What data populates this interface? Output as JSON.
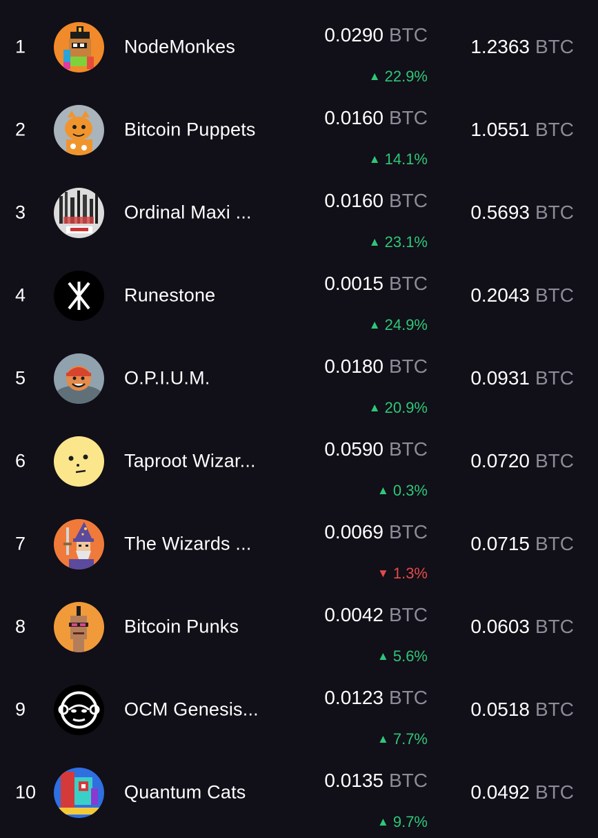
{
  "rows": [
    {
      "rank": "1",
      "name": "NodeMonkes",
      "price": "0.0290",
      "price_unit": "BTC",
      "change_dir": "up",
      "change": "22.9%",
      "volume": "1.2363",
      "volume_unit": "BTC",
      "avatar_icon": "nodemonkes-avatar-icon"
    },
    {
      "rank": "2",
      "name": "Bitcoin Puppets",
      "price": "0.0160",
      "price_unit": "BTC",
      "change_dir": "up",
      "change": "14.1%",
      "volume": "1.0551",
      "volume_unit": "BTC",
      "avatar_icon": "bitcoin-puppets-avatar-icon"
    },
    {
      "rank": "3",
      "name": "Ordinal Maxi ...",
      "price": "0.0160",
      "price_unit": "BTC",
      "change_dir": "up",
      "change": "23.1%",
      "volume": "0.5693",
      "volume_unit": "BTC",
      "avatar_icon": "ordinal-maxi-avatar-icon"
    },
    {
      "rank": "4",
      "name": "Runestone",
      "price": "0.0015",
      "price_unit": "BTC",
      "change_dir": "up",
      "change": "24.9%",
      "volume": "0.2043",
      "volume_unit": "BTC",
      "avatar_icon": "runestone-avatar-icon"
    },
    {
      "rank": "5",
      "name": "O.P.I.U.M.",
      "price": "0.0180",
      "price_unit": "BTC",
      "change_dir": "up",
      "change": "20.9%",
      "volume": "0.0931",
      "volume_unit": "BTC",
      "avatar_icon": "opium-avatar-icon"
    },
    {
      "rank": "6",
      "name": "Taproot Wizar...",
      "price": "0.0590",
      "price_unit": "BTC",
      "change_dir": "up",
      "change": "0.3%",
      "volume": "0.0720",
      "volume_unit": "BTC",
      "avatar_icon": "taproot-wizards-avatar-icon"
    },
    {
      "rank": "7",
      "name": "The Wizards ...",
      "price": "0.0069",
      "price_unit": "BTC",
      "change_dir": "down",
      "change": "1.3%",
      "volume": "0.0715",
      "volume_unit": "BTC",
      "avatar_icon": "the-wizards-avatar-icon"
    },
    {
      "rank": "8",
      "name": "Bitcoin Punks",
      "price": "0.0042",
      "price_unit": "BTC",
      "change_dir": "up",
      "change": "5.6%",
      "volume": "0.0603",
      "volume_unit": "BTC",
      "avatar_icon": "bitcoin-punks-avatar-icon"
    },
    {
      "rank": "9",
      "name": "OCM Genesis...",
      "price": "0.0123",
      "price_unit": "BTC",
      "change_dir": "up",
      "change": "7.7%",
      "volume": "0.0518",
      "volume_unit": "BTC",
      "avatar_icon": "ocm-genesis-avatar-icon"
    },
    {
      "rank": "10",
      "name": "Quantum Cats",
      "price": "0.0135",
      "price_unit": "BTC",
      "change_dir": "up",
      "change": "9.7%",
      "volume": "0.0492",
      "volume_unit": "BTC",
      "avatar_icon": "quantum-cats-avatar-icon"
    }
  ],
  "colors": {
    "background": "#110f17",
    "text": "#ffffff",
    "unit": "#8e8b98",
    "up": "#2ec779",
    "down": "#e24b4b"
  },
  "glyphs": {
    "up": "▲",
    "down": "▼"
  }
}
